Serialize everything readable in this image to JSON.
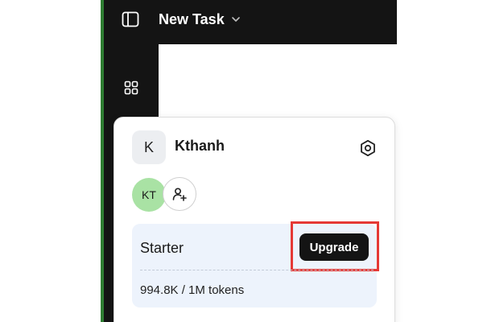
{
  "header": {
    "title": "New Task",
    "title_icon": "chevron-down-icon",
    "sidebar_toggle_icon": "sidebar-toggle-icon"
  },
  "sidebar": {
    "apps_icon": "grid-icon"
  },
  "account": {
    "initial": "K",
    "name": "Kthanh",
    "settings_icon": "gear-icon"
  },
  "members": {
    "avatar_initials": "KT",
    "avatar_color": "#a9e2a4",
    "invite_icon": "add-user-icon"
  },
  "plan": {
    "name": "Starter",
    "upgrade_label": "Upgrade",
    "usage": "994.8K / 1M tokens",
    "highlight_color": "#e53935"
  },
  "colors": {
    "app_bg": "#141414",
    "accent_strip": "#2e7d32",
    "plan_card_bg": "#edf3fc"
  }
}
